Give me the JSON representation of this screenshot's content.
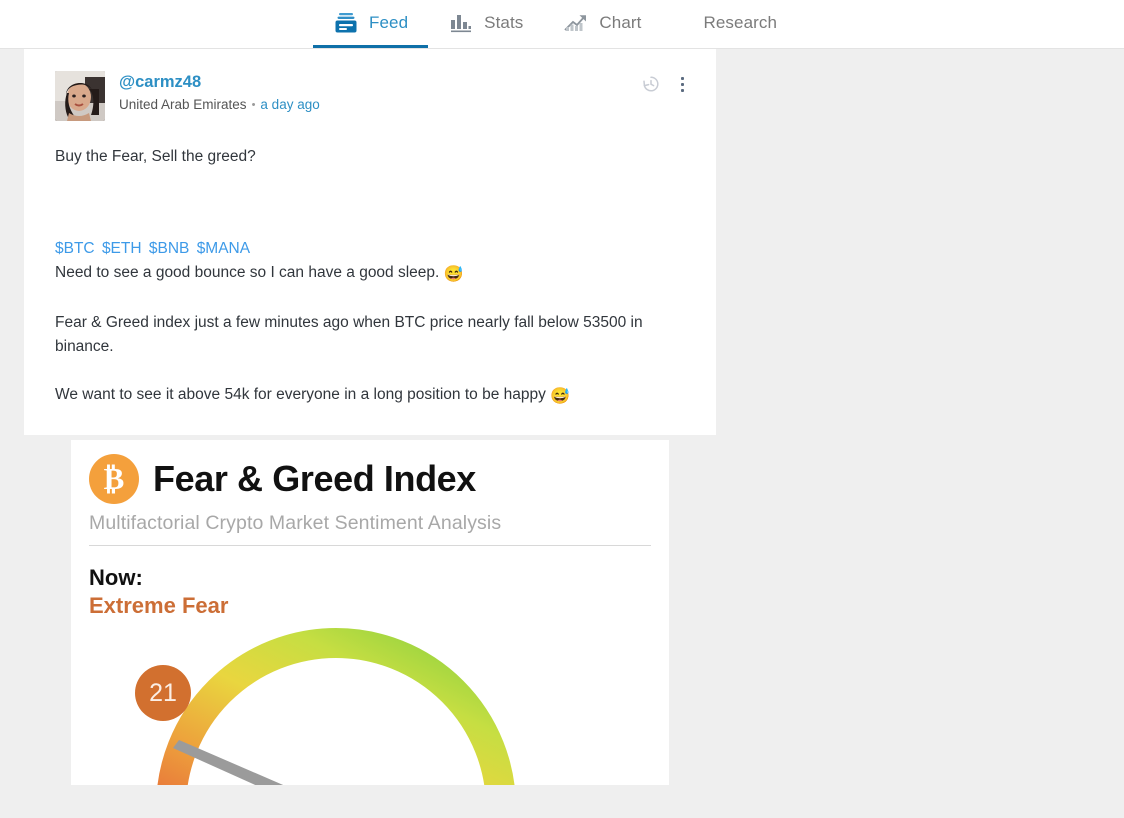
{
  "nav": {
    "tabs": [
      {
        "label": "Feed",
        "icon": "feed-tray-icon",
        "active": true
      },
      {
        "label": "Stats",
        "icon": "bar-chart-icon",
        "active": false
      },
      {
        "label": "Chart",
        "icon": "trend-up-icon",
        "active": false
      },
      {
        "label": "Research",
        "icon": "",
        "active": false
      }
    ],
    "active_underline_color": "#0f70a8",
    "active_label_color": "#2d8fc4"
  },
  "post": {
    "author_handle": "@carmz48",
    "author_location": "United Arab Emirates",
    "separator": "•",
    "timestamp": "a day ago",
    "history_icon": "history-clock-icon",
    "menu_icon": "more-options-kebab-icon",
    "body": {
      "line1": "Buy the Fear, Sell the greed?",
      "cashtags": [
        "$BTC",
        "$ETH",
        "$BNB",
        "$MANA"
      ],
      "line2": "Need to see a good bounce so I can have a good sleep.",
      "line2_emoji": "😅",
      "line3": "Fear & Greed index just a few minutes ago when BTC price nearly fall below  53500 in binance.",
      "line4": "We want to see it above 54k for everyone in a long position to be happy",
      "line4_emoji": "😅"
    },
    "link_color": "#3d9ae8"
  },
  "attachment": {
    "kind": "fear-greed-index-image",
    "logo_symbol": "₿",
    "logo_color": "#f4a03c",
    "title": "Fear & Greed Index",
    "subtitle": "Multifactorial Crypto Market Sentiment Analysis",
    "now_label": "Now:",
    "state_label": "Extreme Fear",
    "state_color": "#cc6e36",
    "gauge": {
      "value": "21",
      "value_number": 21,
      "min": 0,
      "max": 100,
      "badge_color": "#d2702f",
      "needle_color": "#9b9b9b",
      "arc_colors": [
        "#e8803e",
        "#edb33c",
        "#e8d83e",
        "#c3dd40",
        "#86cf3e"
      ]
    }
  },
  "theme": {
    "page_background": "#efefef",
    "card_background": "#ffffff",
    "text_color": "#31363c"
  }
}
